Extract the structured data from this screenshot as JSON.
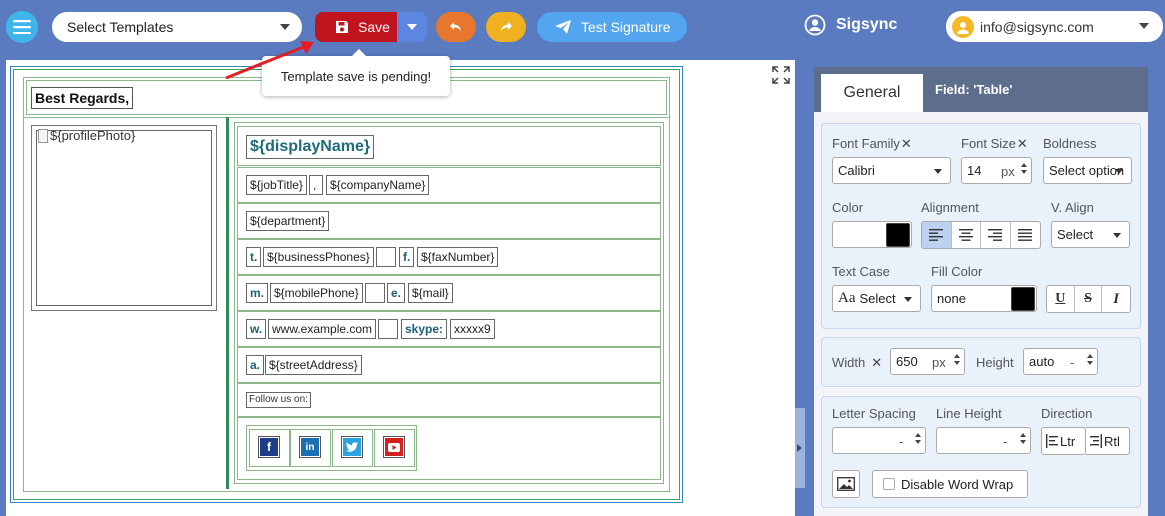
{
  "toolbar": {
    "template_select": "Select Templates",
    "save_label": "Save",
    "test_label": "Test Signature",
    "brand": "Sigsync",
    "account_email": "info@sigsync.com",
    "tooltip": "Template save is pending!"
  },
  "signature": {
    "regards": "Best Regards,",
    "profile_photo": "${profilePhoto}",
    "display_name": "${displayName}",
    "job_title": "${jobTitle}",
    "comma": ",",
    "company_name": "${companyName}",
    "department": "${department}",
    "t_label": "t.",
    "business_phones": "${businessPhones}",
    "f_label": "f.",
    "fax_number": "${faxNumber}",
    "m_label": "m.",
    "mobile_phone": "${mobilePhone}",
    "e_label": "e.",
    "mail": "${mail}",
    "w_label": "w.",
    "website": "www.example.com",
    "skype_label": "skype:",
    "skype": "xxxxx9",
    "a_label": "a.",
    "street_address": "${streetAddress}",
    "follow": "Follow us on:",
    "social": [
      {
        "name": "facebook",
        "glyph": "f",
        "color": "#1f3e87"
      },
      {
        "name": "linkedin",
        "glyph": "in",
        "color": "#1b6fb0"
      },
      {
        "name": "twitter",
        "glyph": "t",
        "color": "#2aa3e3"
      },
      {
        "name": "youtube",
        "glyph": "▶",
        "color": "#d42020"
      }
    ]
  },
  "panel": {
    "tab_general": "General",
    "field_label": "Field: 'Table'",
    "font_family_label": "Font Family",
    "font_family_value": "Calibri",
    "font_size_label": "Font Size",
    "font_size_value": "14",
    "px": "px",
    "boldness_label": "Boldness",
    "boldness_value": "Select option",
    "color_label": "Color",
    "alignment_label": "Alignment",
    "valign_label": "V. Align",
    "valign_value": "Select",
    "text_case_label": "Text Case",
    "text_case_value": "Select",
    "text_case_icon": "Aa",
    "fill_color_label": "Fill Color",
    "fill_color_value": "none",
    "underline": "U",
    "strike": "S",
    "italic": "I",
    "width_label": "Width",
    "width_value": "650",
    "height_label": "Height",
    "height_value": "auto",
    "height_dash": "-",
    "letter_spacing_label": "Letter Spacing",
    "line_height_label": "Line Height",
    "direction_label": "Direction",
    "ltr": "Ltr",
    "rtl": "Rtl",
    "dash": "-",
    "word_wrap": "Disable Word Wrap"
  },
  "colors": {
    "topbar": "#5b7bc0",
    "save": "#c0151f",
    "undo": "#e8772e",
    "redo": "#efb120",
    "test": "#54a5f0",
    "teal_text": "#1e6b7b"
  }
}
